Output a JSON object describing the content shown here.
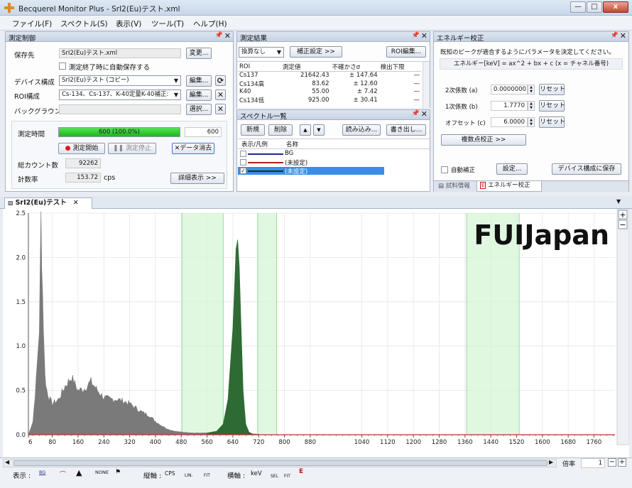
{
  "window": {
    "title": "Becquerel Monitor Plus - SrI2(Eu)テスト.xml",
    "min": "—",
    "max": "□",
    "close": "x"
  },
  "menu": [
    "ファイル(F)",
    "スペクトル(S)",
    "表示(V)",
    "ツール(T)",
    "ヘルプ(H)"
  ],
  "measure_control": {
    "title": "測定制御",
    "save_label": "保存先",
    "save_value": "SrI2(Eu)テスト.xml",
    "change_btn": "変更...",
    "autosave_label": "測定終了時に自動保存する",
    "device_label": "デバイス構成",
    "device_value": "SrI2(Eu)テスト (コピー)",
    "edit_btn": "編集...",
    "roi_label": "ROI構成",
    "roi_value": "Cs-134、Cs-137、K-40定量K-40補正:",
    "bg_label": "バックグラウンド",
    "bg_value": "",
    "select_btn": "選択...",
    "time_label": "測定時間",
    "progress_text": "600 (100.0%)",
    "progress_fraction": 1.0,
    "time_value": "600",
    "start_btn": "測定開始",
    "stop_btn": "測定停止",
    "clear_btn": "データ消去",
    "count_label": "総カウント数",
    "count_value": "92262",
    "rate_label": "計数率",
    "rate_value": "153.72",
    "rate_unit": "cps",
    "detail_btn": "詳細表示 >>"
  },
  "results": {
    "title": "測定結果",
    "mode_value": "換算なし",
    "correct_btn": "補正設定 >>",
    "roi_edit_btn": "ROI編集...",
    "headers": [
      "ROI",
      "測定値",
      "不確かさσ",
      "検出下限"
    ],
    "rows": [
      [
        "Cs137",
        "21642.43",
        "± 147.64",
        "—"
      ],
      [
        "Cs134高",
        "83.62",
        "± 12.60",
        "—"
      ],
      [
        "K40",
        "55.00",
        "± 7.42",
        "—"
      ],
      [
        "Cs134低",
        "925.00",
        "± 30.41",
        "—"
      ]
    ]
  },
  "spectrum_list": {
    "title": "スペクトル一覧",
    "new_btn": "新規",
    "delete_btn": "削除",
    "up": "▲",
    "down": "▼",
    "load_btn": "読み込み...",
    "export_btn": "書き出し...",
    "headers": [
      "表示/凡例",
      "名称"
    ],
    "rows": [
      {
        "name": "BG",
        "color": "#1e2a8a",
        "checked": false
      },
      {
        "name": "(未設定)",
        "color": "#b02020",
        "checked": false
      },
      {
        "name": "(未設定)",
        "color": "#0b3a18",
        "checked": true
      }
    ]
  },
  "energy": {
    "title": "エネルギー校正",
    "desc": "既知のピークが適合するようにパラメータを決定してください。",
    "formula": "エネルギー[keV] = ax^2 + bx + c  (x = チャネル番号)",
    "a_label": "2次係数 (a)",
    "a_value": "0.0000000",
    "b_label": "1次係数 (b)",
    "b_value": "1.7770",
    "c_label": "オフセット (c)",
    "c_value": "6.0000",
    "reset_btn": "リセット",
    "multi_btn": "複数点校正 >>",
    "auto_label": "自動補正",
    "settings_btn": "設定...",
    "save_btn": "デバイス構成に保存",
    "tab_sample": "試料情報",
    "tab_energy": "エネルギー校正"
  },
  "doc_tab": "SrI2(Eu)テスト",
  "chart_data": {
    "type": "area",
    "xlabel": "",
    "ylabel": "",
    "x_ticks": [
      "6",
      "80",
      "160",
      "240",
      "320",
      "400",
      "480",
      "560",
      "640",
      "720",
      "800",
      "880",
      "1040",
      "1120",
      "1200",
      "1280",
      "1360",
      "1440",
      "1520",
      "1600",
      "1680",
      "1760"
    ],
    "y_ticks": [
      "0.0",
      "0.5",
      "1.0",
      "1.5",
      "2.0",
      "2.5"
    ],
    "ylim": [
      0,
      2.5
    ],
    "roi_bands_keV": [
      [
        482,
        610
      ],
      [
        717,
        776
      ],
      [
        1365,
        1528
      ]
    ],
    "series": [
      {
        "name": "",
        "color": "#7a7a7a",
        "x": [
          6,
          20,
          30,
          40,
          45,
          50,
          55,
          60,
          70,
          80,
          100,
          120,
          140,
          160,
          180,
          200,
          220,
          240,
          260,
          280,
          300,
          320,
          340,
          360,
          380,
          400,
          420,
          440,
          460,
          480,
          500,
          520,
          540,
          560
        ],
        "y": [
          0,
          0.15,
          0.6,
          1.2,
          2.45,
          1.6,
          0.9,
          0.55,
          0.42,
          0.35,
          0.4,
          0.55,
          0.65,
          0.5,
          0.52,
          0.6,
          0.5,
          0.42,
          0.4,
          0.4,
          0.38,
          0.35,
          0.3,
          0.25,
          0.22,
          0.15,
          0.1,
          0.06,
          0.04,
          0.03,
          0.025,
          0.02,
          0.02,
          0.02
        ]
      },
      {
        "name": "",
        "color": "#2e6b34",
        "x": [
          560,
          590,
          610,
          625,
          640,
          650,
          655,
          660,
          665,
          672,
          680,
          690,
          700,
          720
        ],
        "y": [
          0.02,
          0.04,
          0.12,
          0.4,
          1.2,
          2.1,
          2.2,
          1.9,
          1.3,
          0.5,
          0.12,
          0.03,
          0.01,
          0.005
        ]
      }
    ]
  },
  "watermark": "FUIJapan",
  "scroll": {
    "zoom_label": "倍率",
    "zoom_value": "1"
  },
  "toolbar": {
    "display_label": "表示 :",
    "vaxis_label": "縦軸 :",
    "vaxis_cps": "CPS",
    "vaxis_lin": "LIN.",
    "vaxis_fit": "FIT",
    "haxis_label": "横軸 :",
    "haxis_unit": "keV",
    "haxis_sel": "SEL",
    "haxis_fit": "FIT",
    "bg_chip": "BG",
    "none_chip": "NONE"
  }
}
